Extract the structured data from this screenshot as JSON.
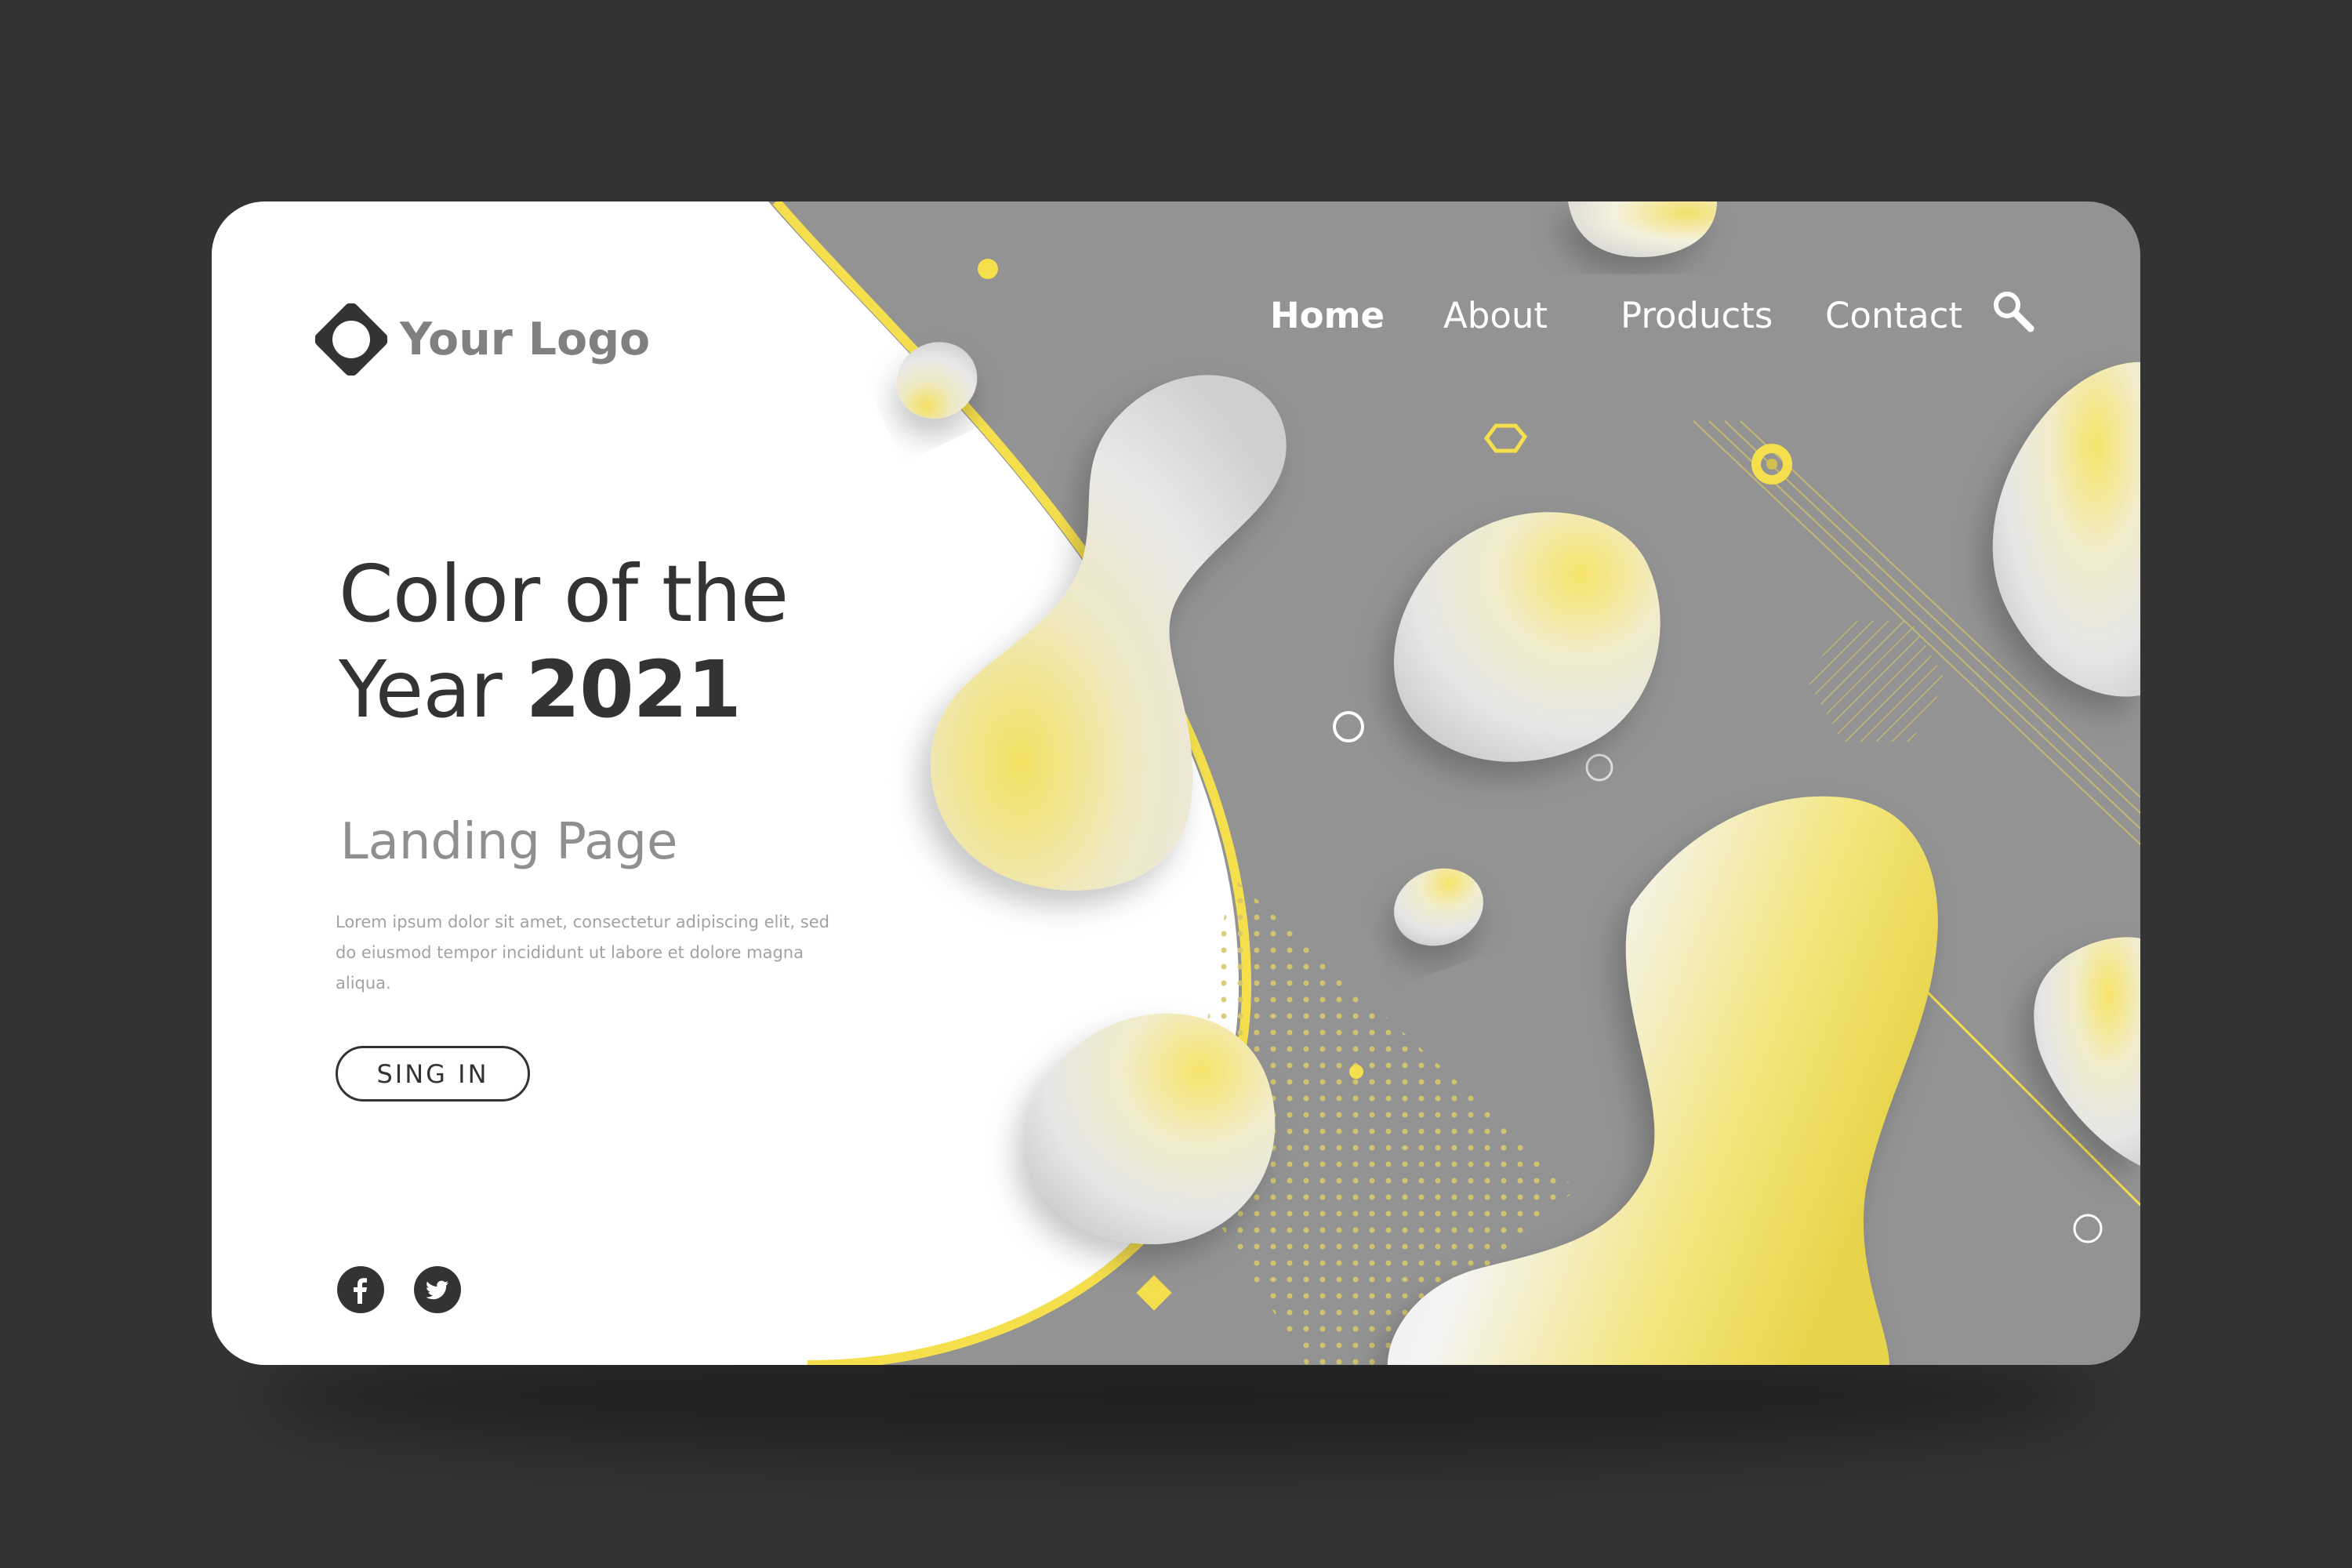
{
  "brand": {
    "logo_text": "Your Logo",
    "logo_icon": "diamond-ring-icon"
  },
  "nav": {
    "items": [
      {
        "label": "Home",
        "active": true
      },
      {
        "label": "About",
        "active": false
      },
      {
        "label": "Products",
        "active": false
      },
      {
        "label": "Contact",
        "active": false
      }
    ],
    "search_icon": "search-icon"
  },
  "hero": {
    "title_line1": "Color of the",
    "title_line2": "Year ",
    "title_year": "2021",
    "subtitle": "Landing Page",
    "body_line1": "Lorem ipsum dolor sit amet, consectetur adipiscing elit, sed",
    "body_line2": "do eiusmod tempor incididunt ut labore et dolore magna",
    "body_line3": "aliqua.",
    "signin_label": "SING IN"
  },
  "social": [
    {
      "name": "facebook",
      "icon": "facebook-icon"
    },
    {
      "name": "twitter",
      "icon": "twitter-icon"
    }
  ],
  "colors": {
    "page_background": "#333333",
    "panel_white": "#ffffff",
    "panel_gray": "#939393",
    "accent_yellow": "#f5df4d",
    "text_dark": "#333333",
    "text_muted": "#8f8f8f"
  }
}
